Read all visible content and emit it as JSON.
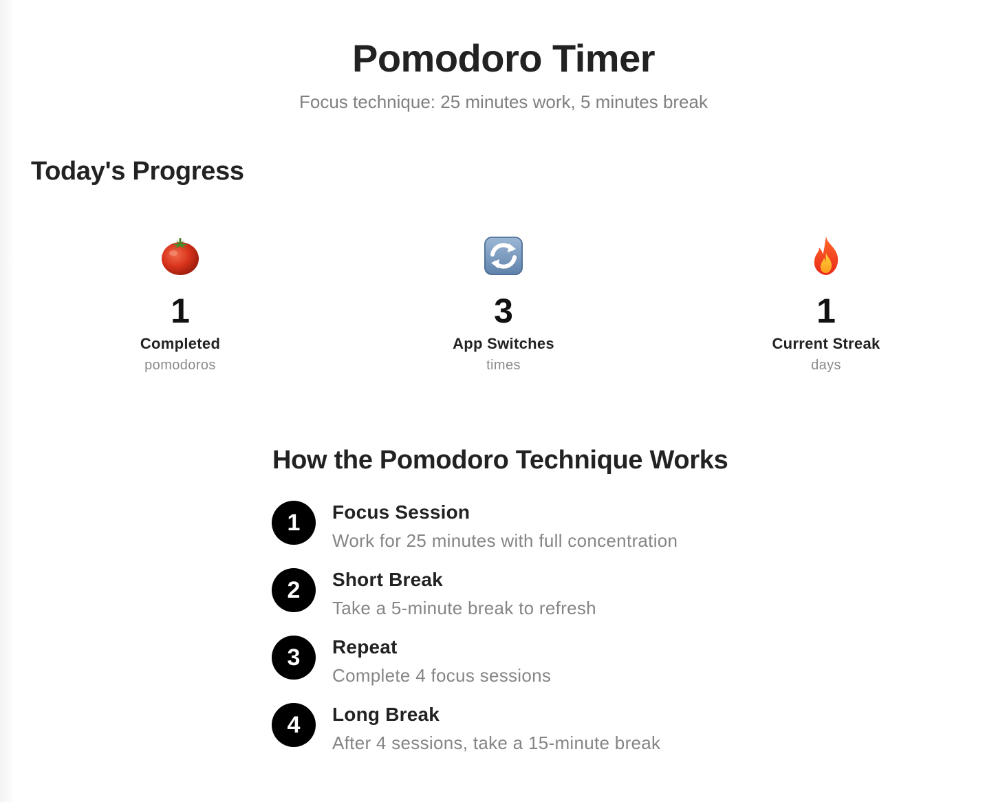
{
  "header": {
    "title": "Pomodoro Timer",
    "subtitle": "Focus technique: 25 minutes work, 5 minutes break"
  },
  "progress": {
    "title": "Today's Progress",
    "stats": [
      {
        "icon": "tomato-icon",
        "value": "1",
        "label": "Completed",
        "unit": "pomodoros"
      },
      {
        "icon": "refresh-icon",
        "value": "3",
        "label": "App Switches",
        "unit": "times"
      },
      {
        "icon": "fire-icon",
        "value": "1",
        "label": "Current Streak",
        "unit": "days"
      }
    ]
  },
  "technique": {
    "title": "How the Pomodoro Technique Works",
    "steps": [
      {
        "number": "1",
        "title": "Focus Session",
        "description": "Work for 25 minutes with full concentration"
      },
      {
        "number": "2",
        "title": "Short Break",
        "description": "Take a 5-minute break to refresh"
      },
      {
        "number": "3",
        "title": "Repeat",
        "description": "Complete 4 focus sessions"
      },
      {
        "number": "4",
        "title": "Long Break",
        "description": "After 4 sessions, take a 15-minute break"
      }
    ]
  },
  "colors": {
    "step_badge": "#000000",
    "muted_text": "#858585",
    "heading_text": "#222222"
  }
}
